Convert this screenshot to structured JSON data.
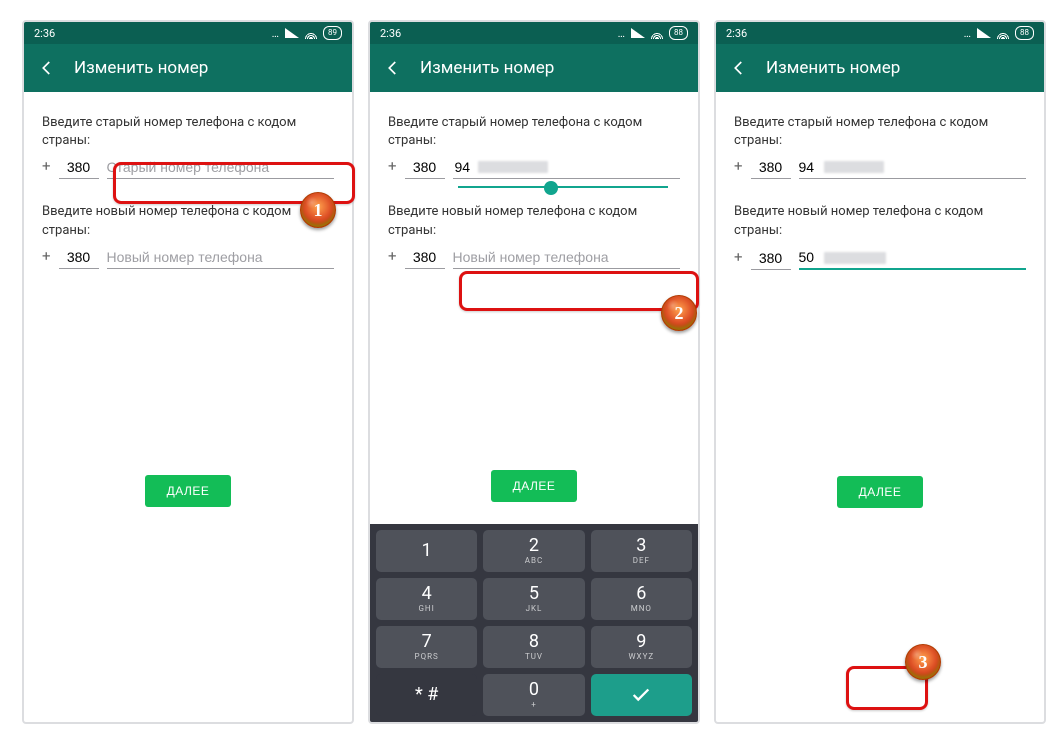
{
  "status": {
    "time": "2:36",
    "battery1": "89",
    "battery2": "88",
    "battery3": "88"
  },
  "appbar": {
    "title": "Изменить номер"
  },
  "labels": {
    "old": "Введите старый номер телефона с кодом страны:",
    "new": "Введите новый номер телефона с кодом страны:"
  },
  "placeholders": {
    "old": "Старый номер телефона",
    "new": "Новый номер телефона"
  },
  "country_code": "380",
  "plus": "+",
  "phone2": {
    "oldPrefix": "94"
  },
  "phone3": {
    "oldPrefix": "94",
    "newPrefix": "50"
  },
  "button": {
    "next": "ДАЛЕЕ"
  },
  "keypad": {
    "k1": {
      "d": "1",
      "s": ""
    },
    "k2": {
      "d": "2",
      "s": "ABC"
    },
    "k3": {
      "d": "3",
      "s": "DEF"
    },
    "k4": {
      "d": "4",
      "s": "GHI"
    },
    "k5": {
      "d": "5",
      "s": "JKL"
    },
    "k6": {
      "d": "6",
      "s": "MNO"
    },
    "k7": {
      "d": "7",
      "s": "PQRS"
    },
    "k8": {
      "d": "8",
      "s": "TUV"
    },
    "k9": {
      "d": "9",
      "s": "WXYZ"
    },
    "k0": {
      "d": "0",
      "s": "+"
    },
    "kstar": {
      "d": "* #",
      "s": ""
    }
  },
  "badges": {
    "b1": "1",
    "b2": "2",
    "b3": "3"
  }
}
